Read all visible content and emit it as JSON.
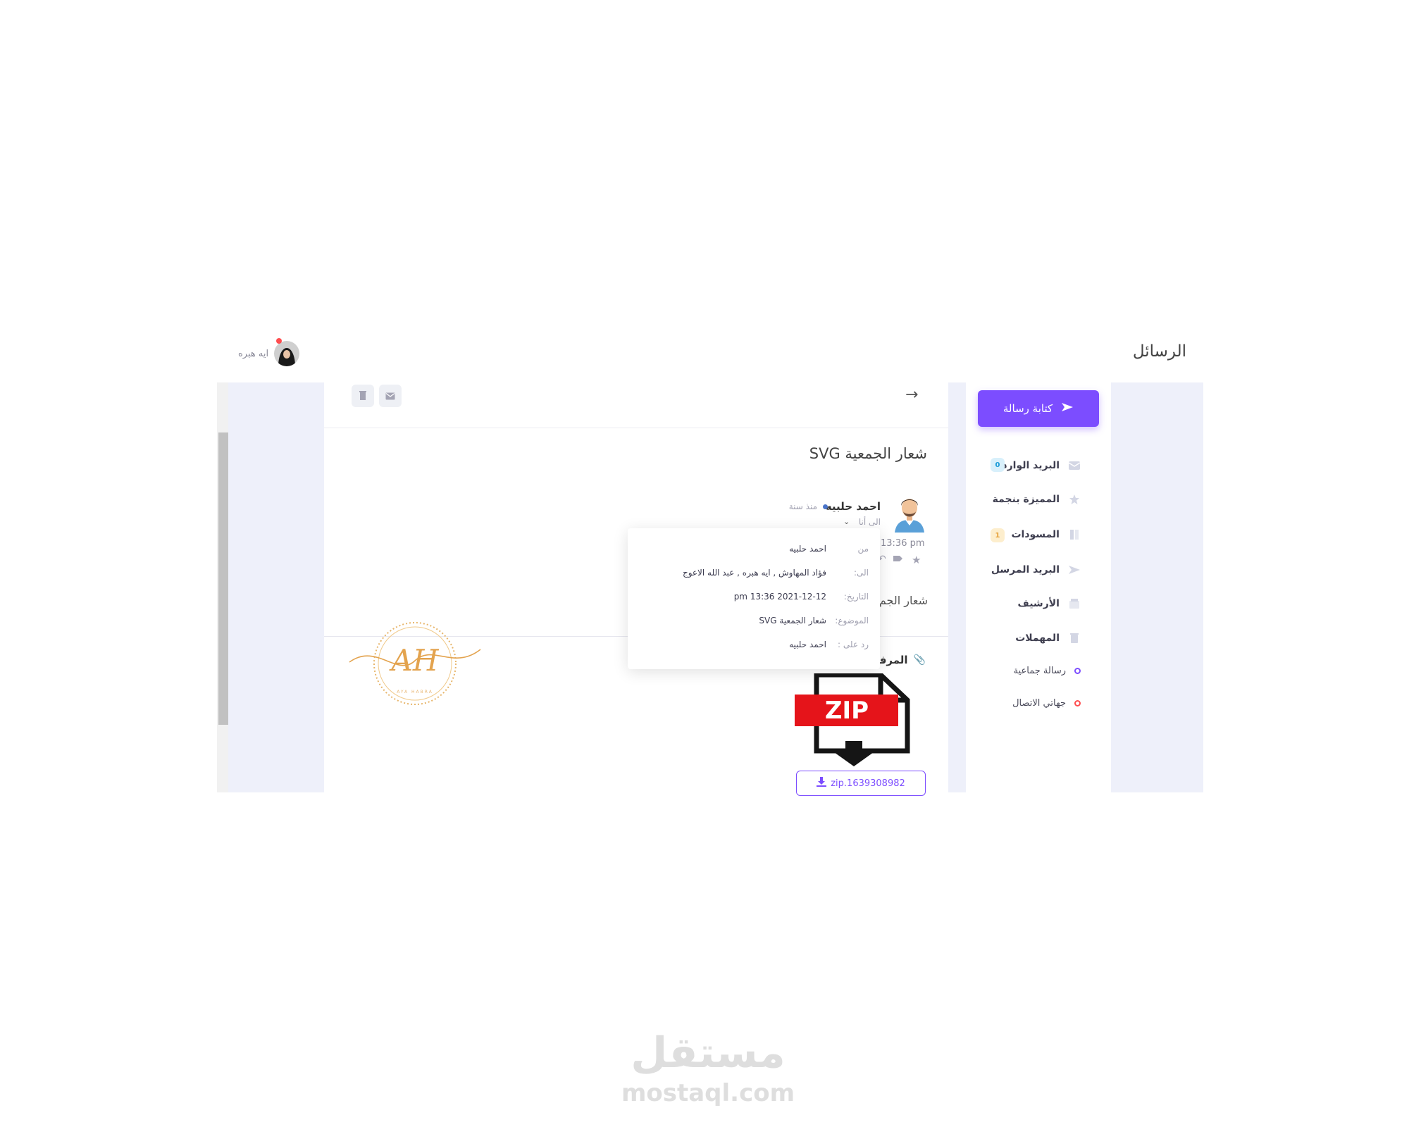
{
  "header": {
    "title": "الرسائل",
    "user_name": "ايه هبره"
  },
  "sidebar": {
    "compose_label": "كتابة رسالة",
    "items": [
      {
        "label": "البريد الوارد",
        "icon": "inbox-icon",
        "badge": "0"
      },
      {
        "label": "المميزة بنجمة",
        "icon": "star-icon"
      },
      {
        "label": "المسودات",
        "icon": "draft-icon",
        "badge": "1"
      },
      {
        "label": "البريد المرسل",
        "icon": "send-icon"
      },
      {
        "label": "الأرشيف",
        "icon": "archive-icon"
      },
      {
        "label": "المهملات",
        "icon": "trash-icon"
      }
    ],
    "extra": [
      {
        "label": "رسالة جماعية",
        "color": "#7c4dff"
      },
      {
        "label": "جهاتي الاتصال",
        "color": "#ff4d4f"
      }
    ]
  },
  "message": {
    "subject": "شعار الجمعية SVG",
    "sender": "احمد حلبيه",
    "when": "منذ سنة",
    "to_me": "الى أنا",
    "time": "13:36 pm",
    "body_snippet": "شعار الجم",
    "attachments_label": "المرفقات",
    "zip_badge": "ZIP",
    "zip_file": "zip.1639308982"
  },
  "details": {
    "from_label": "من",
    "from_value": "احمد حلبيه",
    "to_label": "الى:",
    "to_value": "فؤاد المهاوش , ايه هبره , عبد الله الاعوج",
    "date_label": "التاريخ:",
    "date_value": "2021-12-12 13:36 pm",
    "subject_label": "الموضوع:",
    "subject_value": "شعار الجمعية SVG",
    "reply_label": "رد على :",
    "reply_value": "احمد حلبيه"
  },
  "logo": {
    "initials": "AH",
    "caption": "AYA HABRA"
  },
  "watermark": {
    "arabic": "مستقل",
    "latin": "mostaql.com"
  },
  "colors": {
    "accent": "#7c4dff",
    "zip_red": "#e5141a",
    "frame_bg": "#eef0fa"
  }
}
